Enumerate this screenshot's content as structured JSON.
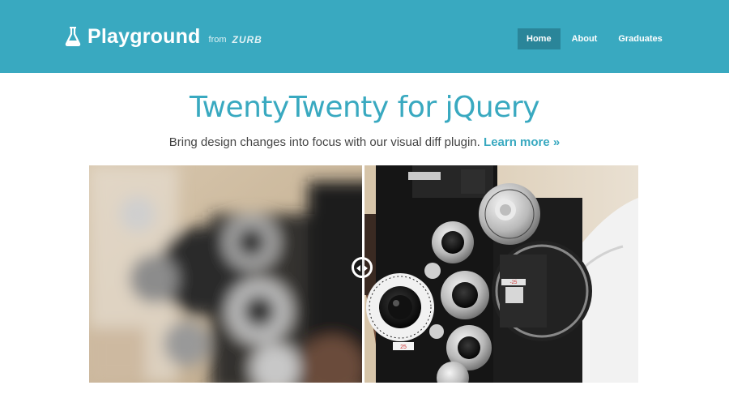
{
  "header": {
    "brand": "Playground",
    "from": "from",
    "company": "ZURB",
    "nav": [
      {
        "label": "Home",
        "active": true
      },
      {
        "label": "About",
        "active": false
      },
      {
        "label": "Graduates",
        "active": false
      }
    ]
  },
  "hero": {
    "title": "TwentyTwenty for jQuery",
    "subtitle": "Bring design changes into focus with our visual diff plugin.",
    "link": "Learn more »"
  },
  "comparison": {
    "split_fraction": 0.5,
    "dial_labels": [
      "25",
      "-25"
    ]
  },
  "colors": {
    "brand": "#39a9c0",
    "nav_active": "#2a8599"
  }
}
